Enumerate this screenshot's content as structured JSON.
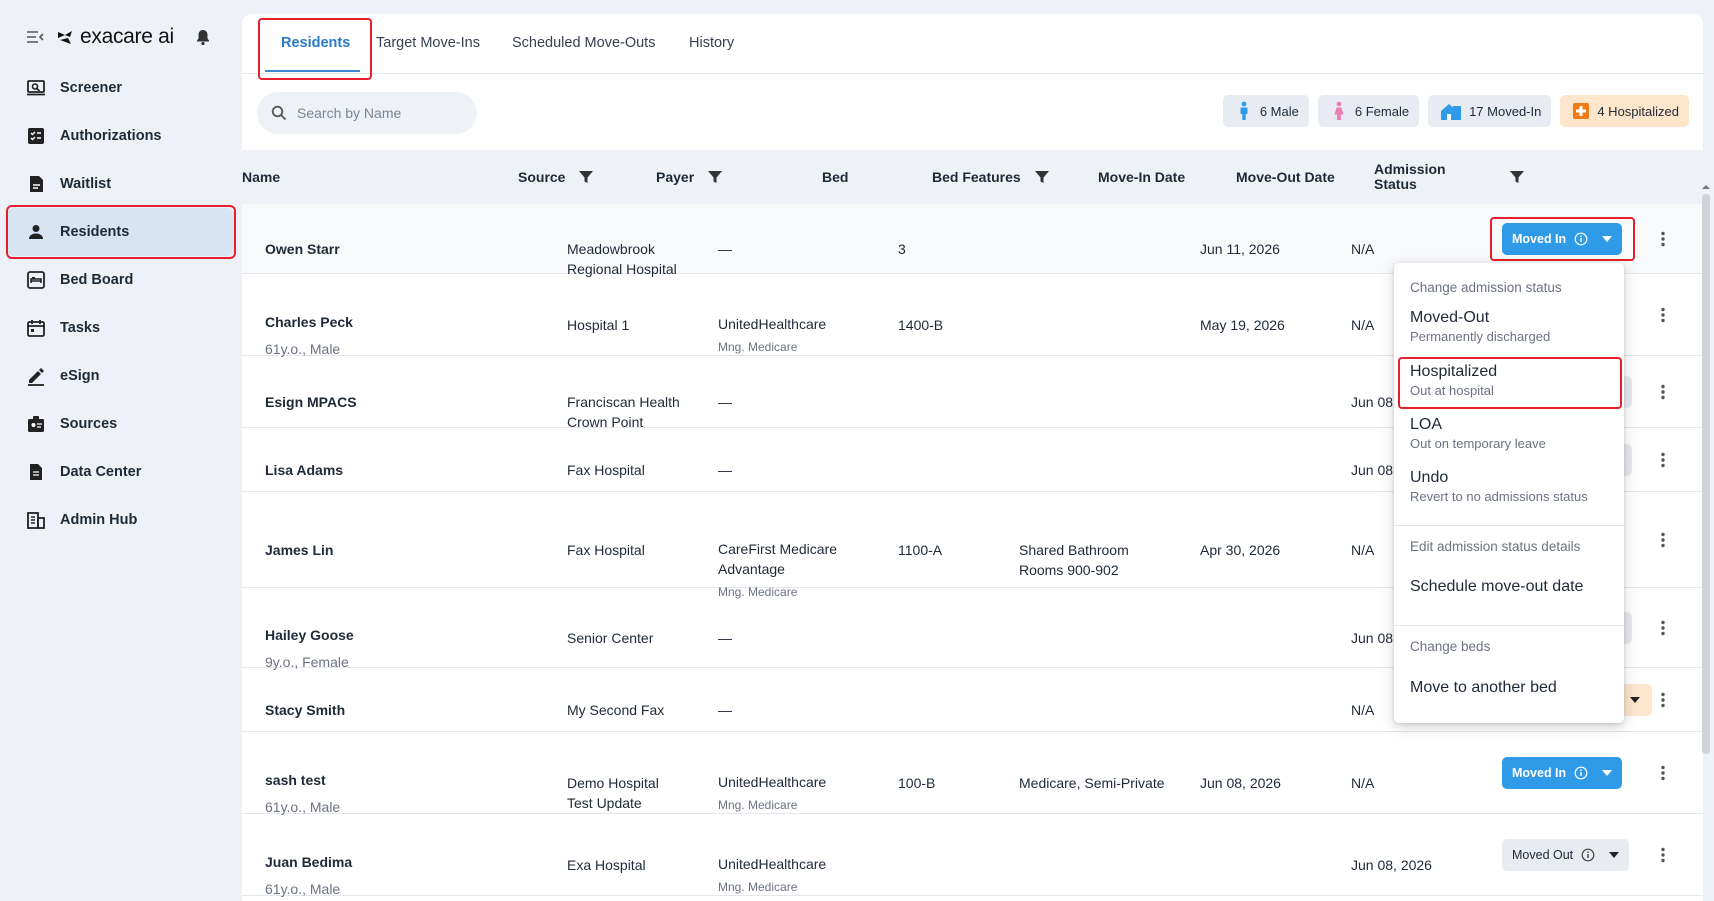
{
  "brand": {
    "name": "exacare ai"
  },
  "sidebar": {
    "items": [
      {
        "label": "Screener",
        "icon": "screener-icon"
      },
      {
        "label": "Authorizations",
        "icon": "authorizations-icon"
      },
      {
        "label": "Waitlist",
        "icon": "waitlist-icon"
      },
      {
        "label": "Residents",
        "icon": "person-icon",
        "active": true
      },
      {
        "label": "Bed Board",
        "icon": "bed-board-icon"
      },
      {
        "label": "Tasks",
        "icon": "calendar-icon"
      },
      {
        "label": "eSign",
        "icon": "pen-icon"
      },
      {
        "label": "Sources",
        "icon": "badge-icon"
      },
      {
        "label": "Data Center",
        "icon": "document-icon"
      },
      {
        "label": "Admin Hub",
        "icon": "building-icon"
      }
    ]
  },
  "tabs": [
    {
      "label": "Residents",
      "active": true
    },
    {
      "label": "Target Move-Ins"
    },
    {
      "label": "Scheduled Move-Outs"
    },
    {
      "label": "History"
    }
  ],
  "search": {
    "placeholder": "Search by Name"
  },
  "summary_chips": {
    "male": "6 Male",
    "female": "6 Female",
    "moved_in": "17 Moved-In",
    "hospitalized": "4 Hospitalized"
  },
  "columns": {
    "name": "Name",
    "source": "Source",
    "payer": "Payer",
    "bed": "Bed",
    "bed_features": "Bed Features",
    "move_in": "Move-In Date",
    "move_out": "Move-Out Date",
    "admission_line1": "Admission",
    "admission_line2": "Status"
  },
  "rows": [
    {
      "name": "Owen Starr",
      "details": "",
      "source1": "Meadowbrook",
      "source2": "Regional Hospital",
      "payer1": "—",
      "payer2": "",
      "payer_plan": "",
      "bed": "3",
      "features1": "",
      "features2": "",
      "move_in": "Jun 11, 2026",
      "move_out": "N/A",
      "status": "Moved In"
    },
    {
      "name": "Charles Peck",
      "details": "61y.o., Male",
      "source1": "Hospital 1",
      "source2": "",
      "payer1": "UnitedHealthcare",
      "payer2": "",
      "payer_plan": "Mng. Medicare",
      "bed": "1400-B",
      "features1": "",
      "features2": "",
      "move_in": "May 19, 2026",
      "move_out": "N/A",
      "status": ""
    },
    {
      "name": "Esign MPACS",
      "details": "",
      "source1": "Franciscan Health",
      "source2": "Crown Point",
      "payer1": "—",
      "payer2": "",
      "payer_plan": "",
      "bed": "",
      "features1": "",
      "features2": "",
      "move_in": "",
      "move_out": "Jun 08",
      "status": ""
    },
    {
      "name": "Lisa Adams",
      "details": "",
      "source1": "Fax Hospital",
      "source2": "",
      "payer1": "—",
      "payer2": "",
      "payer_plan": "",
      "bed": "",
      "features1": "",
      "features2": "",
      "move_in": "",
      "move_out": "Jun 08",
      "status": ""
    },
    {
      "name": "James Lin",
      "details": "",
      "source1": "Fax Hospital",
      "source2": "",
      "payer1": "CareFirst Medicare",
      "payer2": "Advantage",
      "payer_plan": "Mng. Medicare",
      "bed": "1100-A",
      "features1": "Shared Bathroom",
      "features2": "Rooms 900-902",
      "move_in": "Apr 30, 2026",
      "move_out": "N/A",
      "status": ""
    },
    {
      "name": "Hailey Goose",
      "details": "9y.o., Female",
      "source1": "Senior Center",
      "source2": "",
      "payer1": "—",
      "payer2": "",
      "payer_plan": "",
      "bed": "",
      "features1": "",
      "features2": "",
      "move_in": "",
      "move_out": "Jun 08",
      "status": ""
    },
    {
      "name": "Stacy Smith",
      "details": "",
      "source1": "My Second Fax",
      "source2": "",
      "payer1": "—",
      "payer2": "",
      "payer_plan": "",
      "bed": "",
      "features1": "",
      "features2": "",
      "move_in": "",
      "move_out": "N/A",
      "status": ""
    },
    {
      "name": "sash test",
      "details": "61y.o., Male",
      "source1": "Demo Hospital",
      "source2": "Test Update",
      "payer1": "UnitedHealthcare",
      "payer2": "",
      "payer_plan": "Mng. Medicare",
      "bed": "100-B",
      "features1": "Medicare, Semi-Private",
      "features2": "",
      "move_in": "Jun 08, 2026",
      "move_out": "N/A",
      "status": "Moved In"
    },
    {
      "name": "Juan Bedima",
      "details": "61y.o., Male",
      "source1": "Exa Hospital",
      "source2": "",
      "payer1": "UnitedHealthcare",
      "payer2": "",
      "payer_plan": "Mng. Medicare",
      "bed": "",
      "features1": "",
      "features2": "",
      "move_in": "",
      "move_out": "Jun 08, 2026",
      "status": "Moved Out"
    }
  ],
  "menu": {
    "section_change_status": "Change admission status",
    "items": [
      {
        "title": "Moved-Out",
        "subtitle": "Permanently discharged"
      },
      {
        "title": "Hospitalized",
        "subtitle": "Out at hospital"
      },
      {
        "title": "LOA",
        "subtitle": "Out on temporary leave"
      },
      {
        "title": "Undo",
        "subtitle": "Revert to no admissions status"
      }
    ],
    "section_edit": "Edit admission status details",
    "schedule": "Schedule move-out date",
    "section_beds": "Change beds",
    "move_bed": "Move to another bed"
  },
  "colors": {
    "accent_blue": "#2f9be8",
    "tab_active": "#2a7ac9",
    "highlight_red": "#e5202a",
    "hospitalized_bg": "#fde6cc",
    "hospitalized_icon": "#f07a14"
  }
}
